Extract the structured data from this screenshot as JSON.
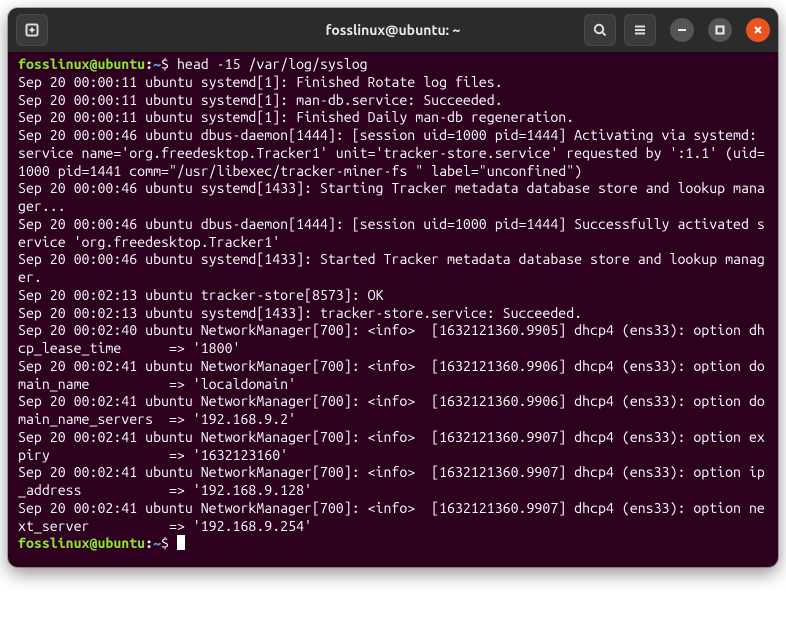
{
  "window": {
    "title": "fosslinux@ubuntu: ~"
  },
  "prompt": {
    "user_host": "fosslinux@ubuntu",
    "sep": ":",
    "path": "~",
    "dollar": "$"
  },
  "session": {
    "command": "head -15 /var/log/syslog",
    "output_lines": [
      "Sep 20 00:00:11 ubuntu systemd[1]: Finished Rotate log files.",
      "Sep 20 00:00:11 ubuntu systemd[1]: man-db.service: Succeeded.",
      "Sep 20 00:00:11 ubuntu systemd[1]: Finished Daily man-db regeneration.",
      "Sep 20 00:00:46 ubuntu dbus-daemon[1444]: [session uid=1000 pid=1444] Activating via systemd: service name='org.freedesktop.Tracker1' unit='tracker-store.service' requested by ':1.1' (uid=1000 pid=1441 comm=\"/usr/libexec/tracker-miner-fs \" label=\"unconfined\")",
      "Sep 20 00:00:46 ubuntu systemd[1433]: Starting Tracker metadata database store and lookup manager...",
      "Sep 20 00:00:46 ubuntu dbus-daemon[1444]: [session uid=1000 pid=1444] Successfully activated service 'org.freedesktop.Tracker1'",
      "Sep 20 00:00:46 ubuntu systemd[1433]: Started Tracker metadata database store and lookup manager.",
      "Sep 20 00:02:13 ubuntu tracker-store[8573]: OK",
      "Sep 20 00:02:13 ubuntu systemd[1433]: tracker-store.service: Succeeded.",
      "Sep 20 00:02:40 ubuntu NetworkManager[700]: <info>  [1632121360.9905] dhcp4 (ens33): option dhcp_lease_time      => '1800'",
      "Sep 20 00:02:41 ubuntu NetworkManager[700]: <info>  [1632121360.9906] dhcp4 (ens33): option domain_name          => 'localdomain'",
      "Sep 20 00:02:41 ubuntu NetworkManager[700]: <info>  [1632121360.9906] dhcp4 (ens33): option domain_name_servers  => '192.168.9.2'",
      "Sep 20 00:02:41 ubuntu NetworkManager[700]: <info>  [1632121360.9907] dhcp4 (ens33): option expiry               => '1632123160'",
      "Sep 20 00:02:41 ubuntu NetworkManager[700]: <info>  [1632121360.9907] dhcp4 (ens33): option ip_address           => '192.168.9.128'",
      "Sep 20 00:02:41 ubuntu NetworkManager[700]: <info>  [1632121360.9907] dhcp4 (ens33): option next_server          => '192.168.9.254'"
    ]
  }
}
